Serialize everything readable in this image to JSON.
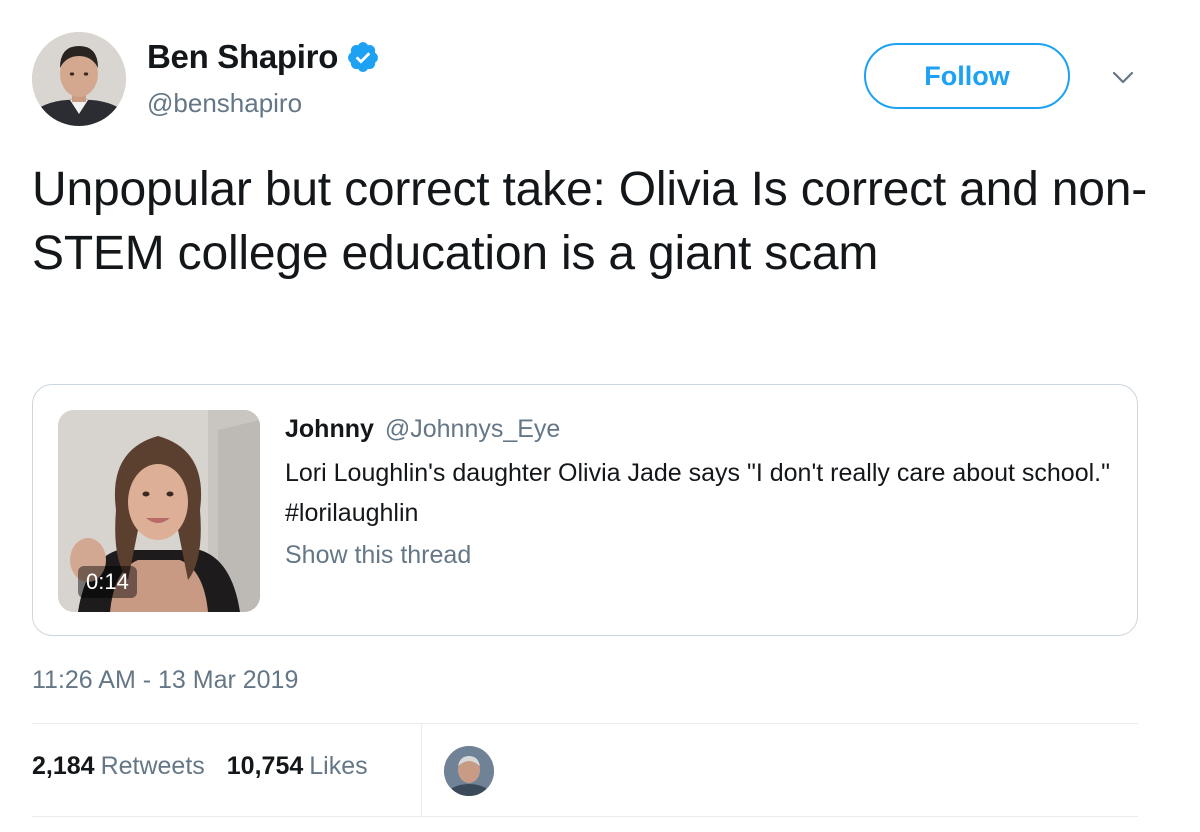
{
  "author": {
    "display_name": "Ben Shapiro",
    "handle": "@benshapiro",
    "verified": true,
    "avatar_icon": "profile-avatar"
  },
  "actions": {
    "follow_label": "Follow",
    "more_icon": "chevron-down-icon"
  },
  "tweet": {
    "text": "Unpopular but correct take: Olivia Is correct and non-STEM college education is a giant scam",
    "timestamp": "11:26 AM - 13 Mar 2019"
  },
  "quoted_tweet": {
    "author_name": "Johnny",
    "author_handle": "@Johnnys_Eye",
    "text": "Lori Loughlin's daughter Olivia Jade says \"I don't really care about school.\" #lorilaughlin",
    "show_thread_label": "Show this thread",
    "video_duration": "0:14"
  },
  "stats": {
    "retweets_count": "2,184",
    "retweets_label": "Retweets",
    "likes_count": "10,754",
    "likes_label": "Likes"
  },
  "colors": {
    "accent": "#1da1f2",
    "text_primary": "#14171a",
    "text_secondary": "#657786",
    "border": "#ccd6dd"
  }
}
